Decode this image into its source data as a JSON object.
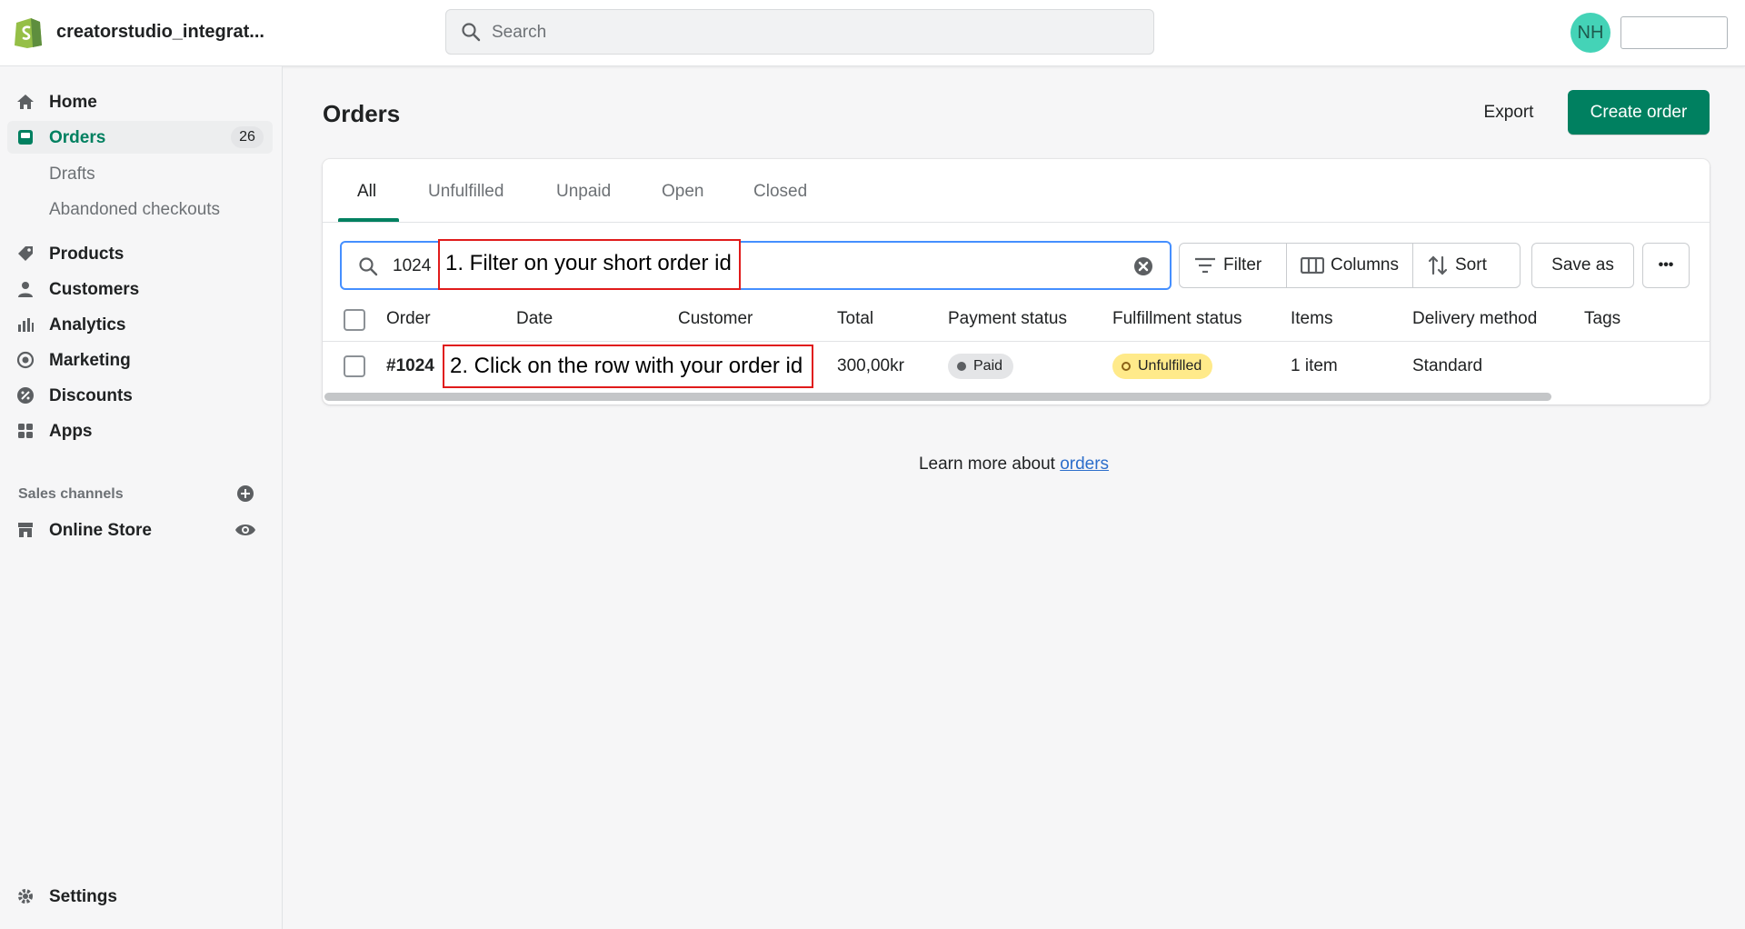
{
  "topbar": {
    "store_name": "creatorstudio_integrat...",
    "search_placeholder": "Search",
    "avatar_initials": "NH",
    "brand_color": "#008060"
  },
  "sidebar": {
    "items": [
      {
        "label": "Home",
        "icon": "home-icon"
      },
      {
        "label": "Orders",
        "icon": "orders-icon",
        "badge": "26",
        "active": true
      },
      {
        "label": "Products",
        "icon": "tag-icon"
      },
      {
        "label": "Customers",
        "icon": "person-icon"
      },
      {
        "label": "Analytics",
        "icon": "bar-chart-icon"
      },
      {
        "label": "Marketing",
        "icon": "target-icon"
      },
      {
        "label": "Discounts",
        "icon": "discount-icon"
      },
      {
        "label": "Apps",
        "icon": "apps-icon"
      }
    ],
    "sub_items": [
      "Drafts",
      "Abandoned checkouts"
    ],
    "sales_channels_label": "Sales channels",
    "online_store_label": "Online Store",
    "settings_label": "Settings"
  },
  "main": {
    "title": "Orders",
    "export_label": "Export",
    "create_label": "Create order",
    "tabs": [
      "All",
      "Unfulfilled",
      "Unpaid",
      "Open",
      "Closed"
    ],
    "active_tab": "All",
    "search_query": "1024",
    "toolbar": {
      "filter": "Filter",
      "columns": "Columns",
      "sort": "Sort",
      "save_as": "Save as",
      "more": "•••"
    },
    "columns": [
      "Order",
      "Date",
      "Customer",
      "Total",
      "Payment status",
      "Fulfillment status",
      "Items",
      "Delivery method",
      "Tags"
    ],
    "rows": [
      {
        "order": "#1024",
        "date": "",
        "customer": "",
        "total": "300,00kr",
        "payment_status": "Paid",
        "fulfillment_status": "Unfulfilled",
        "items": "1 item",
        "delivery_method": "Standard",
        "tags": ""
      }
    ],
    "learn_more_prefix": "Learn more about ",
    "learn_more_link": "orders"
  },
  "annotations": {
    "step1": "1. Filter on your short order id",
    "step2": "2. Click on the row with your order id"
  }
}
